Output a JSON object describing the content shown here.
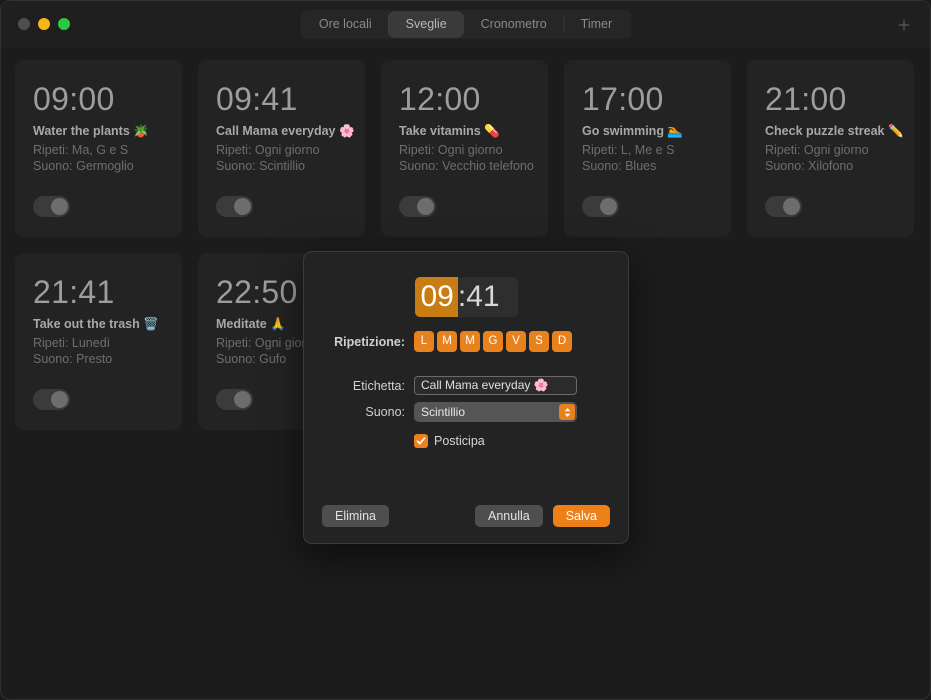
{
  "window": {
    "traffic_lights": [
      "close",
      "minimize",
      "zoom"
    ]
  },
  "toolbar": {
    "tabs": [
      {
        "label": "Ore locali",
        "active": false
      },
      {
        "label": "Sveglie",
        "active": true
      },
      {
        "label": "Cronometro",
        "active": false
      },
      {
        "label": "Timer",
        "active": false
      }
    ],
    "add_button": "+"
  },
  "alarms": [
    {
      "time": "09:00",
      "label": "Water the plants 🪴",
      "repeat": "Ripeti: Ma, G e S",
      "sound": "Suono: Germoglio",
      "enabled": false
    },
    {
      "time": "09:41",
      "label": "Call Mama everyday 🌸",
      "repeat": "Ripeti: Ogni giorno",
      "sound": "Suono: Scintillio",
      "enabled": false
    },
    {
      "time": "12:00",
      "label": "Take vitamins 💊",
      "repeat": "Ripeti: Ogni giorno",
      "sound": "Suono: Vecchio telefono",
      "enabled": false
    },
    {
      "time": "17:00",
      "label": "Go swimming 🏊",
      "repeat": "Ripeti: L, Me e S",
      "sound": "Suono: Blues",
      "enabled": false
    },
    {
      "time": "21:00",
      "label": "Check puzzle streak ✏️",
      "repeat": "Ripeti: Ogni giorno",
      "sound": "Suono: Xilofono",
      "enabled": false
    },
    {
      "time": "21:41",
      "label": "Take out the trash 🗑️",
      "repeat": "Ripeti: Lunedì",
      "sound": "Suono: Presto",
      "enabled": false
    },
    {
      "time": "22:50",
      "label": "Meditate 🙏",
      "repeat": "Ripeti: Ogni giorno",
      "sound": "Suono: Gufo",
      "enabled": false
    }
  ],
  "dialog": {
    "time": {
      "hours": "09",
      "separator": ":",
      "minutes": "41"
    },
    "repeat_label": "Ripetizione:",
    "days": [
      {
        "letter": "L",
        "selected": true
      },
      {
        "letter": "M",
        "selected": true
      },
      {
        "letter": "M",
        "selected": true
      },
      {
        "letter": "G",
        "selected": true
      },
      {
        "letter": "V",
        "selected": true
      },
      {
        "letter": "S",
        "selected": true
      },
      {
        "letter": "D",
        "selected": true
      }
    ],
    "label_field": {
      "label": "Etichetta:",
      "value": "Call Mama everyday 🌸"
    },
    "sound_field": {
      "label": "Suono:",
      "value": "Scintillio"
    },
    "snooze": {
      "label": "Posticipa",
      "checked": true
    },
    "buttons": {
      "delete": "Elimina",
      "cancel": "Annulla",
      "save": "Salva"
    }
  },
  "colors": {
    "accent_orange": "#e8821e",
    "selection_orange": "#c87d12",
    "primary_button": "#ed8019",
    "window_bg": "#1c1c1c",
    "card_bg": "#232323"
  }
}
